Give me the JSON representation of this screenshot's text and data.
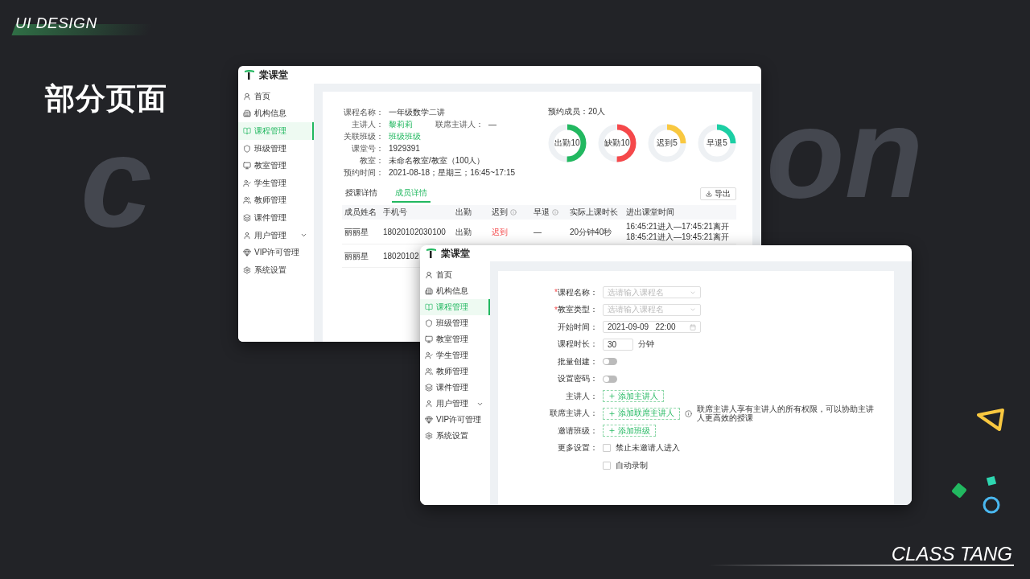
{
  "slide": {
    "tag": "UI DESIGN",
    "title": "部分页面",
    "bg_word_left": "c",
    "bg_word_right": "on",
    "footer": "CLASS TANG"
  },
  "detail_window": {
    "app_name": "棠课堂",
    "sidebar": [
      {
        "label": "首页",
        "selected": false,
        "expandable": false
      },
      {
        "label": "机构信息",
        "selected": false,
        "expandable": false
      },
      {
        "label": "课程管理",
        "selected": true,
        "expandable": false
      },
      {
        "label": "班级管理",
        "selected": false,
        "expandable": false
      },
      {
        "label": "教室管理",
        "selected": false,
        "expandable": false
      },
      {
        "label": "学生管理",
        "selected": false,
        "expandable": false
      },
      {
        "label": "教师管理",
        "selected": false,
        "expandable": false
      },
      {
        "label": "课件管理",
        "selected": false,
        "expandable": false
      },
      {
        "label": "用户管理",
        "selected": false,
        "expandable": true
      },
      {
        "label": "VIP许可管理",
        "selected": false,
        "expandable": false
      },
      {
        "label": "系统设置",
        "selected": false,
        "expandable": false
      }
    ],
    "course_info": [
      {
        "pairs": [
          {
            "label": "课程名称：",
            "value": "一年级数学二讲",
            "kind": "text"
          }
        ]
      },
      {
        "pairs": [
          {
            "label": "主讲人：",
            "value": "黎莉莉",
            "kind": "link"
          },
          {
            "label": "联席主讲人：",
            "value": "—",
            "kind": "text"
          }
        ]
      },
      {
        "pairs": [
          {
            "label": "关联班级：",
            "value": "班级班级",
            "kind": "link"
          }
        ]
      },
      {
        "pairs": [
          {
            "label": "课堂号：",
            "value": "1929391",
            "kind": "text"
          }
        ]
      },
      {
        "pairs": [
          {
            "label": "教室：",
            "value": "未命名教室/教室（100人）",
            "kind": "text"
          }
        ]
      },
      {
        "pairs": [
          {
            "label": "预约时间：",
            "value": "2021-08-18；星期三；16:45~17:15",
            "kind": "text"
          }
        ]
      }
    ],
    "stats": {
      "title": "预约成员：20人",
      "items": [
        {
          "label": "出勤10",
          "level": 0.5,
          "color": "#22b860"
        },
        {
          "label": "缺勤10",
          "level": 0.5,
          "color": "#f5484a"
        },
        {
          "label": "迟到5",
          "level": 0.25,
          "color": "#f9c840"
        },
        {
          "label": "早退5",
          "level": 0.25,
          "color": "#1ccfa4"
        }
      ]
    },
    "tabs": [
      {
        "label": "授课详情",
        "selected": false
      },
      {
        "label": "成员详情",
        "selected": true
      }
    ],
    "export_button": "导出",
    "table": {
      "columns": [
        {
          "label": "成员姓名",
          "info": false
        },
        {
          "label": "手机号",
          "info": false
        },
        {
          "label": "出勤",
          "info": false
        },
        {
          "label": "迟到",
          "info": true
        },
        {
          "label": "早退",
          "info": true
        },
        {
          "label": "实际上课时长",
          "info": false
        },
        {
          "label": "进出课堂时间",
          "info": false
        }
      ],
      "rows": [
        {
          "cells": [
            {
              "lines": [
                "丽丽星"
              ],
              "alert": false
            },
            {
              "lines": [
                "18020102030100"
              ],
              "alert": false
            },
            {
              "lines": [
                "出勤"
              ],
              "alert": false
            },
            {
              "lines": [
                "迟到"
              ],
              "alert": true
            },
            {
              "lines": [
                "—"
              ],
              "alert": false
            },
            {
              "lines": [
                "20分钟40秒"
              ],
              "alert": false
            },
            {
              "lines": [
                "16:45:21进入—17:45:21离开",
                "18:45:21进入—19:45:21离开"
              ],
              "alert": false
            }
          ]
        },
        {
          "cells": [
            {
              "lines": [
                "丽丽星"
              ],
              "alert": false
            },
            {
              "lines": [
                "18020102"
              ],
              "alert": false
            }
          ]
        }
      ]
    }
  },
  "form_window": {
    "app_name": "棠课堂",
    "sidebar": [
      {
        "label": "首页",
        "selected": false,
        "expandable": false
      },
      {
        "label": "机构信息",
        "selected": false,
        "expandable": false
      },
      {
        "label": "课程管理",
        "selected": true,
        "expandable": false
      },
      {
        "label": "班级管理",
        "selected": false,
        "expandable": false
      },
      {
        "label": "教室管理",
        "selected": false,
        "expandable": false
      },
      {
        "label": "学生管理",
        "selected": false,
        "expandable": false
      },
      {
        "label": "教师管理",
        "selected": false,
        "expandable": false
      },
      {
        "label": "课件管理",
        "selected": false,
        "expandable": false
      },
      {
        "label": "用户管理",
        "selected": false,
        "expandable": true
      },
      {
        "label": "VIP许可管理",
        "selected": false,
        "expandable": false
      },
      {
        "label": "系统设置",
        "selected": false,
        "expandable": false
      }
    ],
    "form": [
      {
        "kind": "select",
        "mark": "*",
        "label": "课程名称：",
        "placeholder": "选请输入课程名"
      },
      {
        "kind": "select",
        "mark": "*",
        "label": "教室类型：",
        "placeholder": "选请输入课程名"
      },
      {
        "kind": "date",
        "label": "开始时间：",
        "value": "2021-09-09   22:00"
      },
      {
        "kind": "number",
        "label": "课程时长：",
        "value": "30",
        "unit": "分钟"
      },
      {
        "kind": "switch",
        "label": "批量创建：",
        "on": false
      },
      {
        "kind": "switch",
        "label": "设置密码：",
        "on": false
      },
      {
        "kind": "add",
        "label": "主讲人：",
        "button": "添加主讲人"
      },
      {
        "kind": "add",
        "label": "联席主讲人：",
        "button": "添加联席主讲人",
        "hint": "联席主讲人享有主讲人的所有权限，可以协助主讲人更高效的授课"
      },
      {
        "kind": "add",
        "label": "邀请班级：",
        "button": "添加班级"
      },
      {
        "kind": "checkbox",
        "label": "更多设置：",
        "option": "禁止未邀请人进入",
        "checked": false
      },
      {
        "kind": "checkbox",
        "option": "自动录制",
        "checked": false
      }
    ]
  }
}
